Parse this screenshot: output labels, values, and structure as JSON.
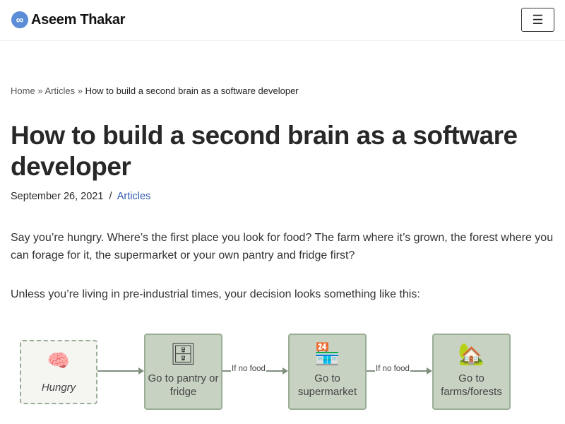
{
  "header": {
    "site_name": "Aseem Thakar",
    "logo_icon": "infinity-icon",
    "menu_icon": "hamburger-icon"
  },
  "breadcrumb": {
    "home": "Home",
    "sep": "»",
    "articles": "Articles",
    "current": "How to build a second brain as a software developer"
  },
  "article": {
    "title": "How to build a second brain as a software developer",
    "date": "September 26, 2021",
    "meta_sep": "/",
    "category": "Articles",
    "p1": "Say you’re hungry. Where’s the first place you look for food? The farm where it’s grown, the forest where you can forage for it, the supermarket or your own pantry and fridge first?",
    "p2": "Unless you’re living in pre-industrial times, your decision looks something like this:"
  },
  "diagram": {
    "start": "Hungry",
    "steps": [
      "Go to pantry or fridge",
      "Go to supermarket",
      "Go to farms/forests"
    ],
    "edge_label": "If no food"
  }
}
